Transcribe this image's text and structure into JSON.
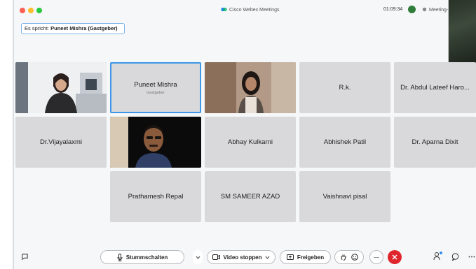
{
  "window": {
    "title": "Cisco Webex Meetings",
    "timer": "01:09:34",
    "meeting_info": "Meeting-I"
  },
  "speaker": {
    "prefix": "Es spricht:",
    "name": "Puneet Mishra (Gastgeber)"
  },
  "participants": [
    {
      "name": "",
      "video": true
    },
    {
      "name": "Puneet Mishra",
      "role": "Gastgeber",
      "active": true
    },
    {
      "name": "",
      "video": true
    },
    {
      "name": "R.k."
    },
    {
      "name": "Dr. Abdul Lateef Haro..."
    },
    {
      "name": "Dr.Vijayalaxmi"
    },
    {
      "name": "",
      "video": true
    },
    {
      "name": "Abhay Kulkarni"
    },
    {
      "name": "Abhishek Patil"
    },
    {
      "name": "Dr. Aparna Dixit"
    },
    {
      "name": "Prathamesh Repal"
    },
    {
      "name": "SM SAMEER AZAD"
    },
    {
      "name": "Vaishnavi pisal"
    }
  ],
  "toolbar": {
    "mute_label": "Stummschalten",
    "video_label": "Video stoppen",
    "share_label": "Freigeben"
  },
  "colors": {
    "accent": "#3d96e6",
    "end_call": "#e0262d",
    "tile_bg": "#d9d9db"
  }
}
